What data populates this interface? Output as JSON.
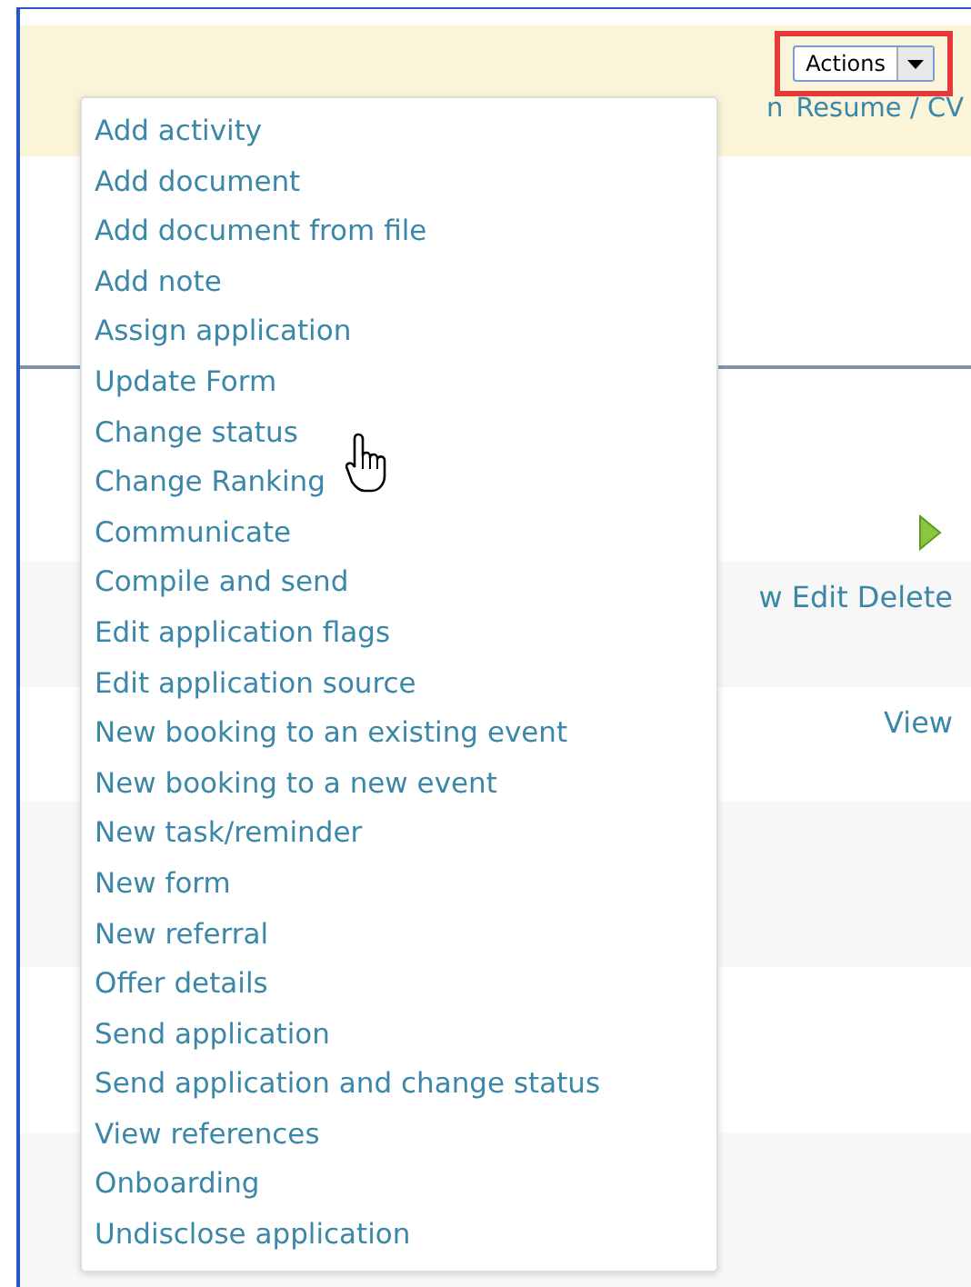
{
  "header": {
    "actions_button": {
      "label": "Actions"
    },
    "links": [
      "n",
      "Resume / CV"
    ]
  },
  "table": {
    "rows": [
      {
        "cells": [
          "w Edit Delete"
        ]
      },
      {
        "cells": [
          "View"
        ]
      }
    ]
  },
  "menu": {
    "items": [
      "Add activity",
      "Add document",
      "Add document from file",
      "Add note",
      "Assign application",
      "Update Form",
      "Change status",
      "Change Ranking",
      "Communicate",
      "Compile and send",
      "Edit application flags",
      "Edit application source",
      "New booking to an existing event",
      "New booking to a new event",
      "New task/reminder",
      "New form",
      "New referral",
      "Offer details",
      "Send application",
      "Send application and change status",
      "View references",
      "Onboarding",
      "Undisclose application"
    ]
  }
}
